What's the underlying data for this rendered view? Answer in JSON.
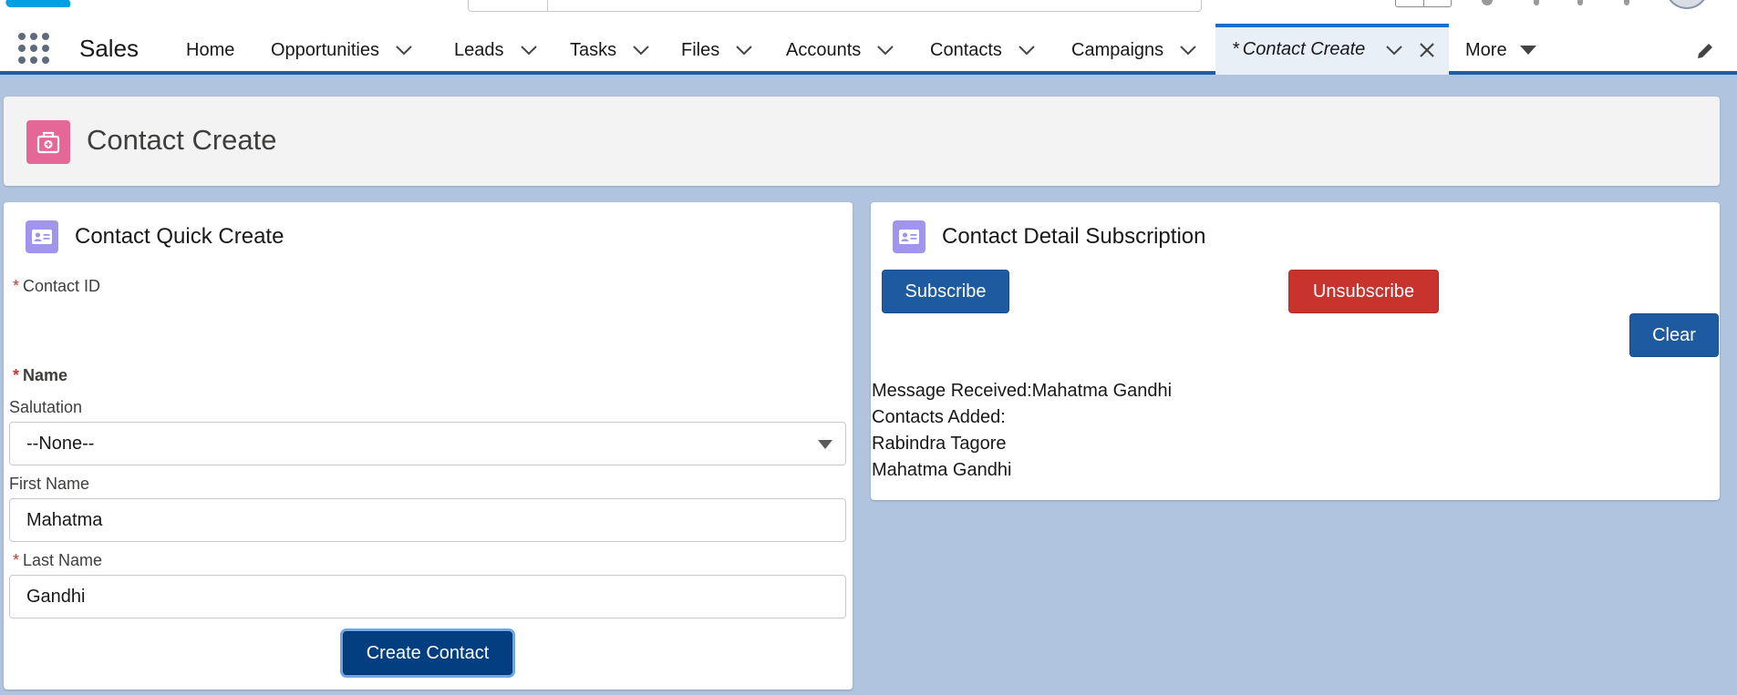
{
  "app": {
    "name": "Sales"
  },
  "nav": {
    "items": [
      {
        "label": "Home",
        "has_menu": false
      },
      {
        "label": "Opportunities",
        "has_menu": true
      },
      {
        "label": "Leads",
        "has_menu": true
      },
      {
        "label": "Tasks",
        "has_menu": true
      },
      {
        "label": "Files",
        "has_menu": true
      },
      {
        "label": "Accounts",
        "has_menu": true
      },
      {
        "label": "Contacts",
        "has_menu": true
      },
      {
        "label": "Campaigns",
        "has_menu": true
      }
    ],
    "active_tab": {
      "prefix": "*",
      "label": "Contact Create"
    },
    "more_label": "More"
  },
  "page": {
    "title": "Contact Create",
    "icon": "first-aid-kit-icon",
    "icon_color": "#e56798"
  },
  "quick_create": {
    "title": "Contact Quick Create",
    "icon": "contact-card-icon",
    "contact_id_label": "Contact ID",
    "name_label": "Name",
    "salutation_label": "Salutation",
    "salutation_value": "--None--",
    "first_name_label": "First Name",
    "first_name_value": "Mahatma",
    "last_name_label": "Last Name",
    "last_name_value": "Gandhi",
    "required_marker": "*",
    "create_button": "Create Contact"
  },
  "subscription": {
    "title": "Contact Detail Subscription",
    "icon": "contact-card-icon",
    "subscribe_button": "Subscribe",
    "unsubscribe_button": "Unsubscribe",
    "clear_button": "Clear",
    "message_received": "Message Received:Mahatma Gandhi",
    "contacts_added_label": "Contacts Added:",
    "contacts": [
      "Rabindra Tagore",
      "Mahatma Gandhi"
    ]
  },
  "colors": {
    "brand_blue": "#1d5aa0",
    "danger_red": "#c8332e",
    "nav_accent": "#1b5fa8",
    "card_icon": "#a094ed",
    "background": "#b0c4df"
  }
}
